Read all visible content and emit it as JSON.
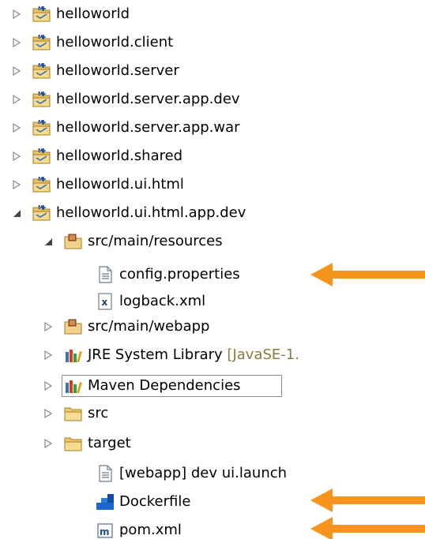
{
  "tree": {
    "rows": [
      {
        "label": "helloworld",
        "icon": "maven-project-folder-icon",
        "state": "collapsed"
      },
      {
        "label": "helloworld.client",
        "icon": "maven-project-folder-icon",
        "state": "collapsed"
      },
      {
        "label": "helloworld.server",
        "icon": "maven-project-folder-icon",
        "state": "collapsed"
      },
      {
        "label": "helloworld.server.app.dev",
        "icon": "maven-project-folder-icon",
        "state": "collapsed"
      },
      {
        "label": "helloworld.server.app.war",
        "icon": "maven-project-folder-icon",
        "state": "collapsed"
      },
      {
        "label": "helloworld.shared",
        "icon": "maven-project-folder-icon",
        "state": "collapsed"
      },
      {
        "label": "helloworld.ui.html",
        "icon": "maven-project-folder-icon",
        "state": "collapsed"
      },
      {
        "label": "helloworld.ui.html.app.dev",
        "icon": "maven-project-folder-icon",
        "state": "expanded"
      },
      {
        "label": "src/main/resources",
        "icon": "source-folder-icon",
        "state": "expanded"
      },
      {
        "label": "config.properties",
        "icon": "text-file-icon",
        "state": "leaf"
      },
      {
        "label": "logback.xml",
        "icon": "xml-file-icon",
        "state": "leaf"
      },
      {
        "label": "src/main/webapp",
        "icon": "source-folder-icon",
        "state": "collapsed"
      },
      {
        "label": "JRE System Library",
        "decoration": "[JavaSE-1.",
        "icon": "library-icon",
        "state": "collapsed"
      },
      {
        "label": "Maven Dependencies",
        "icon": "library-icon",
        "state": "collapsed",
        "selected": true
      },
      {
        "label": "src",
        "icon": "folder-icon",
        "state": "collapsed"
      },
      {
        "label": "target",
        "icon": "folder-icon",
        "state": "collapsed"
      },
      {
        "label": "[webapp] dev ui.launch",
        "icon": "launch-file-icon",
        "state": "leaf"
      },
      {
        "label": "Dockerfile",
        "icon": "docker-icon",
        "state": "leaf"
      },
      {
        "label": "pom.xml",
        "icon": "maven-pom-icon",
        "state": "leaf"
      }
    ]
  },
  "colors": {
    "arrow": "#f7941d",
    "text": "#000000",
    "decoration": "#8c7b3d",
    "toggle": "#8a8a8a",
    "selection_border": "#8c8c8c"
  },
  "annotations": [
    {
      "target": "config.properties",
      "icon": "arrow-left-icon"
    },
    {
      "target": "Dockerfile",
      "icon": "arrow-left-icon"
    },
    {
      "target": "pom.xml",
      "icon": "arrow-left-icon"
    }
  ]
}
